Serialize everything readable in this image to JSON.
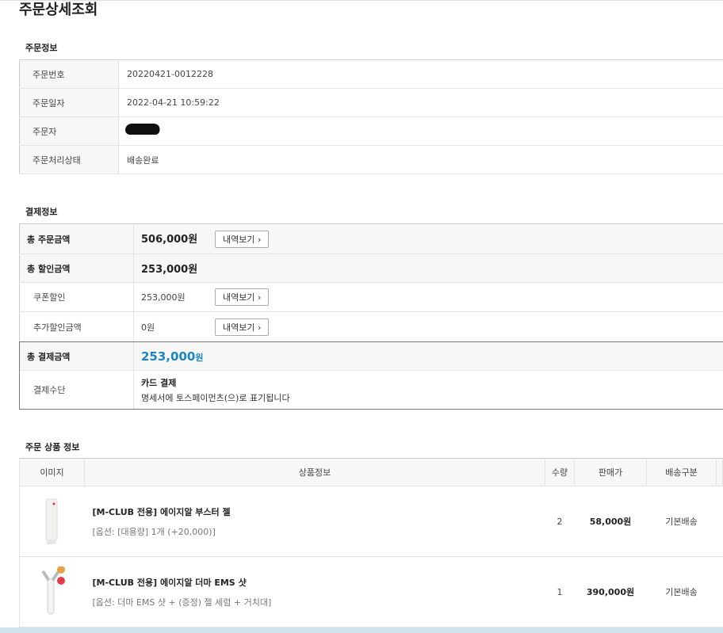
{
  "title": "주문상세조회",
  "order_info": {
    "heading": "주문정보",
    "rows": [
      {
        "label": "주문번호",
        "value": "20220421-0012228"
      },
      {
        "label": "주문일자",
        "value": "2022-04-21 10:59:22"
      },
      {
        "label": "주문자",
        "value": ""
      },
      {
        "label": "주문처리상태",
        "value": "배송완료"
      }
    ]
  },
  "payment": {
    "heading": "결제정보",
    "total_order": {
      "label": "총 주문금액",
      "value": "506,000원",
      "button": "내역보기 ›"
    },
    "total_discount": {
      "label": "총 할인금액",
      "value": "253,000원"
    },
    "coupon": {
      "label": "쿠폰할인",
      "value": "253,000원",
      "button": "내역보기 ›"
    },
    "extra": {
      "label": "추가할인금액",
      "value": "0원",
      "button": "내역보기 ›"
    },
    "total_paid": {
      "label": "총 결제금액",
      "value": "253,000",
      "unit": "원"
    },
    "method": {
      "label": "결제수단",
      "value": "카드 결제",
      "note": "명세서에 토스페이먼츠(으)로 표기됩니다"
    }
  },
  "products": {
    "heading": "주문 상품 정보",
    "columns": [
      "이미지",
      "상품정보",
      "수량",
      "판매가",
      "배송구분"
    ],
    "items": [
      {
        "name": "[M-CLUB 전용] 에이지알 부스터 젤",
        "option": "[옵션: [대용량] 1개 (+20,000)]",
        "qty": "2",
        "price": "58,000원",
        "shipping": "기본배송"
      },
      {
        "name": "[M-CLUB 전용] 에이지알 더마 EMS 샷",
        "option": "[옵션: 더마 EMS 샷 + (증정) 젤 세럼 + 거치대]",
        "qty": "1",
        "price": "390,000원",
        "shipping": "기본배송"
      }
    ]
  },
  "colors": {
    "accent": "#1a86c8"
  }
}
